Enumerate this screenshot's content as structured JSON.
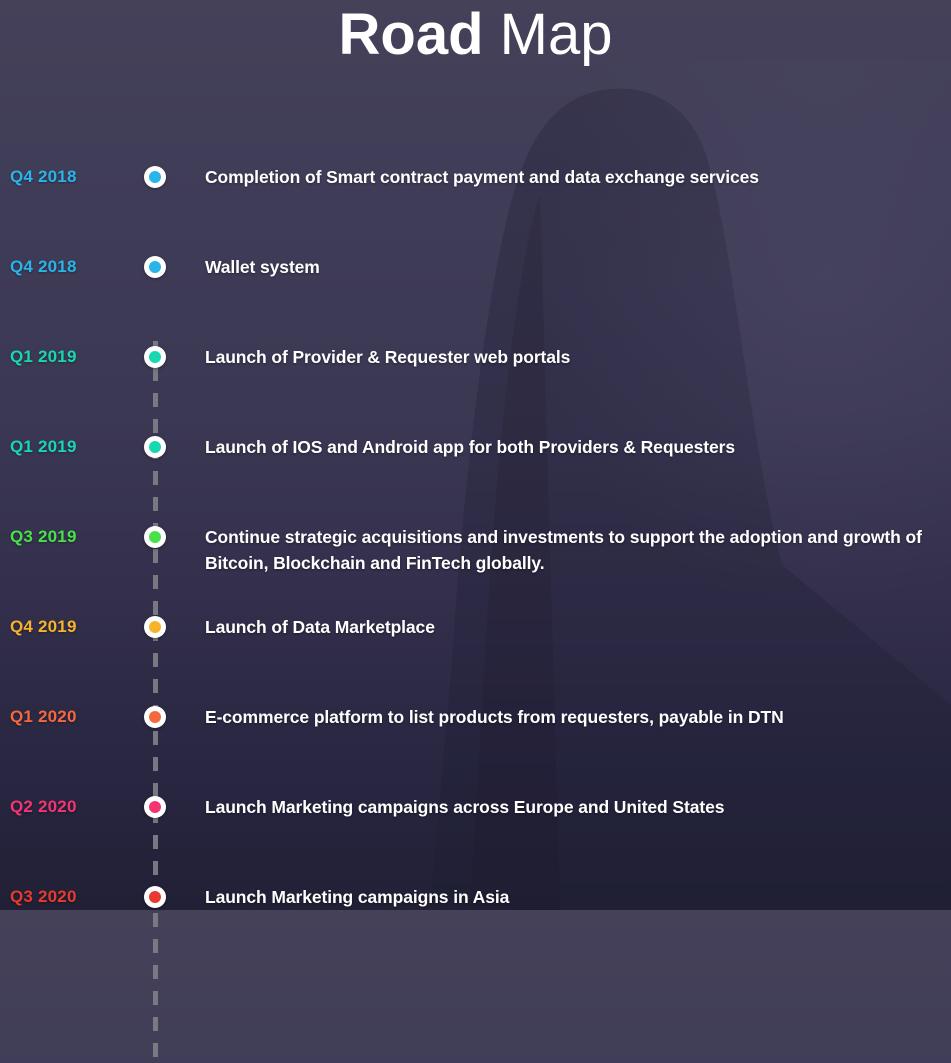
{
  "title": {
    "bold": "Road",
    "light": "Map"
  },
  "colors": {
    "background_top": "#454159",
    "background_bottom": "#212035",
    "dash_line": "#7c7c86",
    "dot_ring": "#ffffff",
    "text": "#ffffff"
  },
  "timeline": {
    "items": [
      {
        "quarter": "Q4 2018",
        "color": "#29b4ea",
        "text": "Completion of Smart contract payment and data exchange services"
      },
      {
        "quarter": "Q4 2018",
        "color": "#29b4ea",
        "text": "Wallet system"
      },
      {
        "quarter": "Q1 2019",
        "color": "#17d8b2",
        "text": "Launch of Provider & Requester web portals"
      },
      {
        "quarter": "Q1 2019",
        "color": "#17d8b2",
        "text": "Launch of IOS and Android app for both Providers & Requesters"
      },
      {
        "quarter": "Q3 2019",
        "color": "#47e247",
        "text": "Continue strategic acquisitions and investments to support the adoption and growth of Bitcoin, Blockchain and FinTech globally."
      },
      {
        "quarter": "Q4 2019",
        "color": "#f7b32a",
        "text": "Launch of Data Marketplace"
      },
      {
        "quarter": "Q1 2020",
        "color": "#f4683e",
        "text": "E-commerce platform to list products from requesters, payable in DTN"
      },
      {
        "quarter": "Q2 2020",
        "color": "#f43572",
        "text": "Launch Marketing campaigns across Europe and United States"
      },
      {
        "quarter": "Q3 2020",
        "color": "#e83a30",
        "text": "Launch Marketing campaigns in Asia"
      }
    ]
  }
}
